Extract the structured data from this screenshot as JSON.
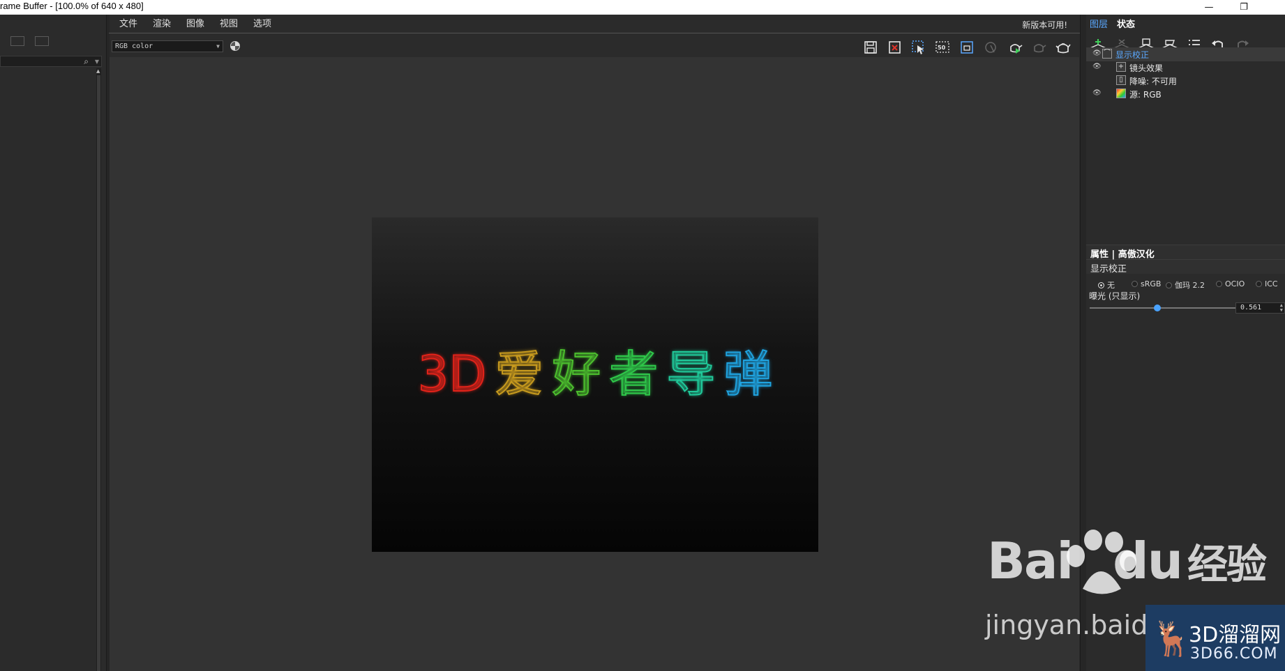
{
  "window": {
    "title": "rame Buffer - [100.0% of 640 x 480]",
    "min_icon": "minimize-icon",
    "restore_icon": "restore-icon"
  },
  "menu": {
    "items": [
      "文件",
      "渲染",
      "图像",
      "视图",
      "选项"
    ],
    "new_version": "新版本可用!"
  },
  "toolbar": {
    "channel": "RGB color",
    "buttons": [
      "save-icon",
      "clear-icon",
      "region-select-icon",
      "zoom-50-icon",
      "region-render-icon",
      "track-mouse-icon",
      "render-teapot-icon",
      "stop-teapot-icon",
      "teapot-icon"
    ],
    "zoom_label": "50"
  },
  "render": {
    "text": [
      "3D",
      "爱",
      "好",
      "者",
      "导",
      "弹"
    ],
    "colors": [
      "#e2231a",
      "#c79a1e",
      "#4cbf2e",
      "#2fc84a",
      "#20c99a",
      "#1fa3e0"
    ]
  },
  "right_panel": {
    "tabs": [
      "图层",
      "状态"
    ],
    "layers": [
      {
        "label": "显示校正",
        "eye": true,
        "icon": "⌒"
      },
      {
        "label": "镜头效果",
        "eye": true,
        "icon": "+"
      },
      {
        "label": "降噪: 不可用",
        "eye": false,
        "icon": "▯"
      },
      {
        "label": "源: RGB",
        "eye": true,
        "icon": "▦"
      }
    ],
    "props_title": "属性 | 高傲汉化",
    "props_section": "显示校正",
    "options": [
      "无",
      "sRGB",
      "伽玛 2.2",
      "OCIO",
      "ICC"
    ],
    "selected_option": "无",
    "exposure_label": "曝光 (只显示)",
    "exposure_value": "0.561",
    "exposure_fraction": 0.46
  },
  "watermark": {
    "brand": "Bai",
    "brand2": "du",
    "brand_cn": "经验",
    "url": "jingyan.baidu",
    "site": "3D溜溜网",
    "site_url": "3D66.COM"
  }
}
